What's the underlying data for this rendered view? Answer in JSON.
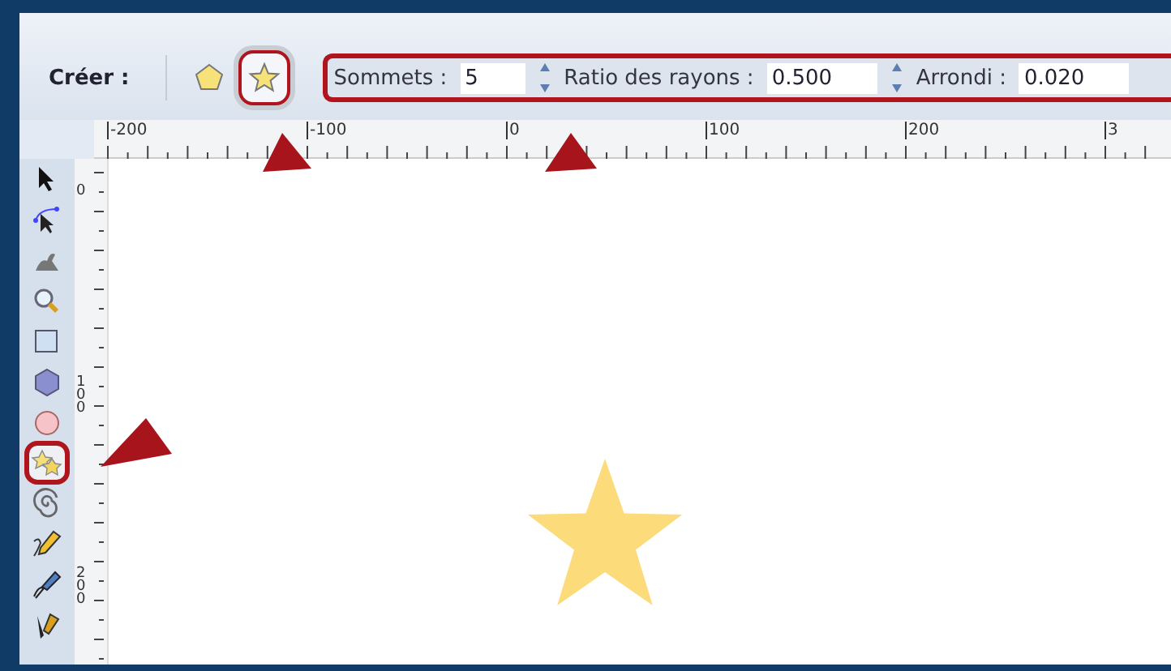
{
  "toolbar": {
    "label": "Créer :",
    "shape_toggles": [
      {
        "kind": "polygon",
        "selected": false
      },
      {
        "kind": "star",
        "selected": true
      }
    ],
    "fields": [
      {
        "label": "Sommets :",
        "value": "5"
      },
      {
        "label": "Ratio des rayons :",
        "value": "0.500"
      },
      {
        "label": "Arrondi :",
        "value": "0.020"
      }
    ]
  },
  "ruler_horizontal": [
    "-200",
    "-100",
    "0",
    "100",
    "200",
    "3"
  ],
  "ruler_vertical": [
    "0",
    "100",
    "200"
  ],
  "tools": [
    {
      "selected": false
    },
    {
      "selected": false
    },
    {
      "selected": false
    },
    {
      "selected": false
    },
    {
      "selected": false
    },
    {
      "selected": false
    },
    {
      "selected": false
    },
    {
      "selected": true
    },
    {
      "selected": false
    },
    {
      "selected": false
    },
    {
      "selected": false
    },
    {
      "selected": false
    }
  ]
}
